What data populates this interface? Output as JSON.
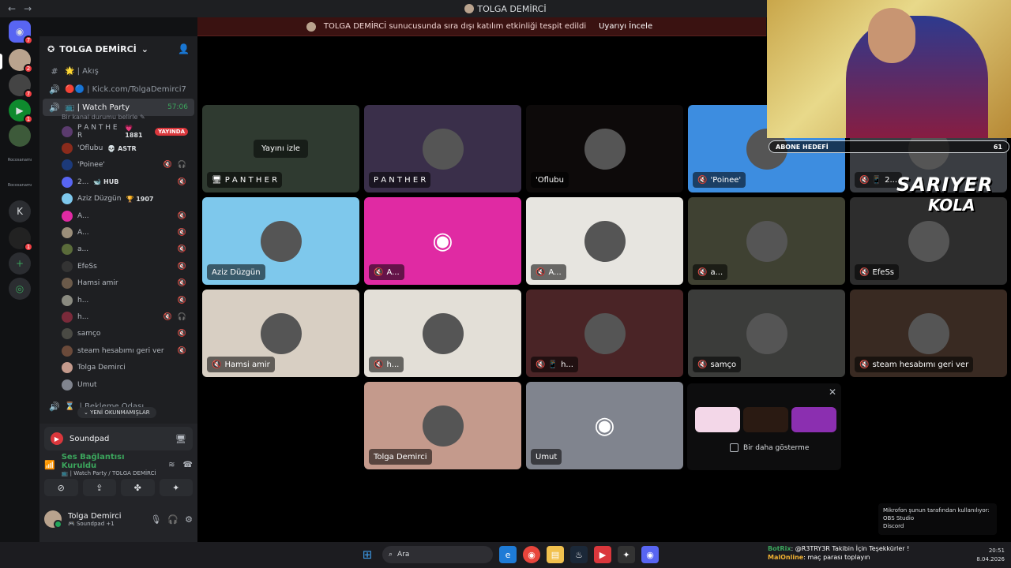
{
  "window": {
    "title": "TOLGA DEMİRCİ",
    "back": "←",
    "forward": "→"
  },
  "banner": {
    "text": "TOLGA DEMİRCİ sunucusunda sıra dışı katılım etkinliği tespit edildi",
    "button": "Uyarıyı İncele"
  },
  "rail": {
    "badges": [
      "7",
      "2",
      "7",
      "1",
      "1"
    ],
    "labels": [
      "Rocosanamı",
      "Rocosanamı"
    ],
    "letter": "K"
  },
  "server": {
    "name": "TOLGA DEMİRCİ"
  },
  "channels": [
    {
      "icon": "#",
      "name": "🌟 | Akış"
    },
    {
      "icon": "🔊",
      "name": "🔴🔵 | Kick.com/TolgaDemirci7"
    },
    {
      "icon": "🔊",
      "name": "📺 | Watch Party",
      "timer": "57:06"
    }
  ],
  "status_line": "Bir kanal durumu belirle ✎",
  "voice_users": [
    {
      "name": "P A N T H E R",
      "extra": "💗 1881",
      "live": "YAYINDA"
    },
    {
      "name": "'Oflubu",
      "extra": "💀 ASTR"
    },
    {
      "name": "'Poinee'",
      "flags": "🔇 🎧"
    },
    {
      "name": "2...",
      "extra": "🐋 HUB",
      "flags": "🔇"
    },
    {
      "name": "Aziz Düzgün",
      "extra": "🏆 1907"
    },
    {
      "name": "A...",
      "flags": "🔇"
    },
    {
      "name": "A...",
      "flags": "🔇"
    },
    {
      "name": "a...",
      "flags": "🔇"
    },
    {
      "name": "EfeSs",
      "flags": "🔇"
    },
    {
      "name": "Hamsi amir",
      "flags": "🔇"
    },
    {
      "name": "h...",
      "flags": "🔇"
    },
    {
      "name": "h...",
      "flags": "🔇 🎧"
    },
    {
      "name": "samço",
      "flags": "🔇"
    },
    {
      "name": "steam hesabımı geri ver",
      "flags": "🔇"
    },
    {
      "name": "Tolga Demirci"
    },
    {
      "name": "Umut"
    }
  ],
  "waiting_channel": "| Bekleme Odası",
  "new_unread": "⌄ YENİ OKUNMAMIŞLAR",
  "panel": {
    "soundpad": "Soundpad",
    "rtc_title": "Ses Bağlantısı Kuruldu",
    "rtc_sub": "📺 | Watch Party / TOLGA DEMİRCİ",
    "username": "Tolga Demirci",
    "user_status": "🎮 Soundpad +1"
  },
  "tiles": [
    {
      "label": "P A N T H E R",
      "icon": "🖥",
      "watch": "Yayını izle",
      "bg": "#2f3a30"
    },
    {
      "label": "P A N T H E R",
      "bg": "#3a2f4a"
    },
    {
      "label": "'Oflubu",
      "bg": "#0d0a0a"
    },
    {
      "label": "'Poinee'",
      "icon": "🔇",
      "bg": "#3d8de0"
    },
    {
      "label": "2...",
      "icon": "🔇 📱",
      "bg": "#3a3d42"
    },
    {
      "label": "Aziz Düzgün",
      "bg": "#7ec8ec"
    },
    {
      "label": "A...",
      "icon": "🔇",
      "bg": "#e02aa3"
    },
    {
      "label": "A...",
      "icon": "🔇",
      "bg": "#e7e5e0"
    },
    {
      "label": "a...",
      "icon": "🔇",
      "bg": "#3f4132"
    },
    {
      "label": "EfeSs",
      "icon": "🔇",
      "bg": "#2d2d2d"
    },
    {
      "label": "Hamsi amir",
      "icon": "🔇",
      "bg": "#d8cfc3"
    },
    {
      "label": "h...",
      "icon": "🔇",
      "bg": "#e3dfd7"
    },
    {
      "label": "h...",
      "icon": "🔇 📱",
      "bg": "#4a2426"
    },
    {
      "label": "samço",
      "icon": "🔇",
      "bg": "#3b3c3a"
    },
    {
      "label": "steam hesabımı geri ver",
      "icon": "🔇",
      "bg": "#392a22"
    },
    {
      "label": "Tolga Demirci",
      "bg": "#c49a8c"
    },
    {
      "label": "Umut",
      "bg": "#80848e"
    }
  ],
  "suggest": {
    "close": "✕",
    "checkbox": "Bir daha gösterme"
  },
  "stream_overlay": {
    "goal_label": "ABONE HEDEFİ",
    "goal_value": "61",
    "brand_top": "SARIYER",
    "brand_bottom": "KOLA"
  },
  "toast": {
    "line1": "Mikrofon şunun tarafından kullanılıyor:",
    "line2": "OBS Studio",
    "line3": "Discord"
  },
  "taskbar": {
    "search": "Ara",
    "time": "20:51",
    "date": "8.04.2026"
  },
  "chat": {
    "user1": "BotRix",
    "text1": ": @R3TRY3R Takibin İçin Teşekkürler !",
    "user2": "MalOnline",
    "text2": ": maç parası toplayın"
  }
}
